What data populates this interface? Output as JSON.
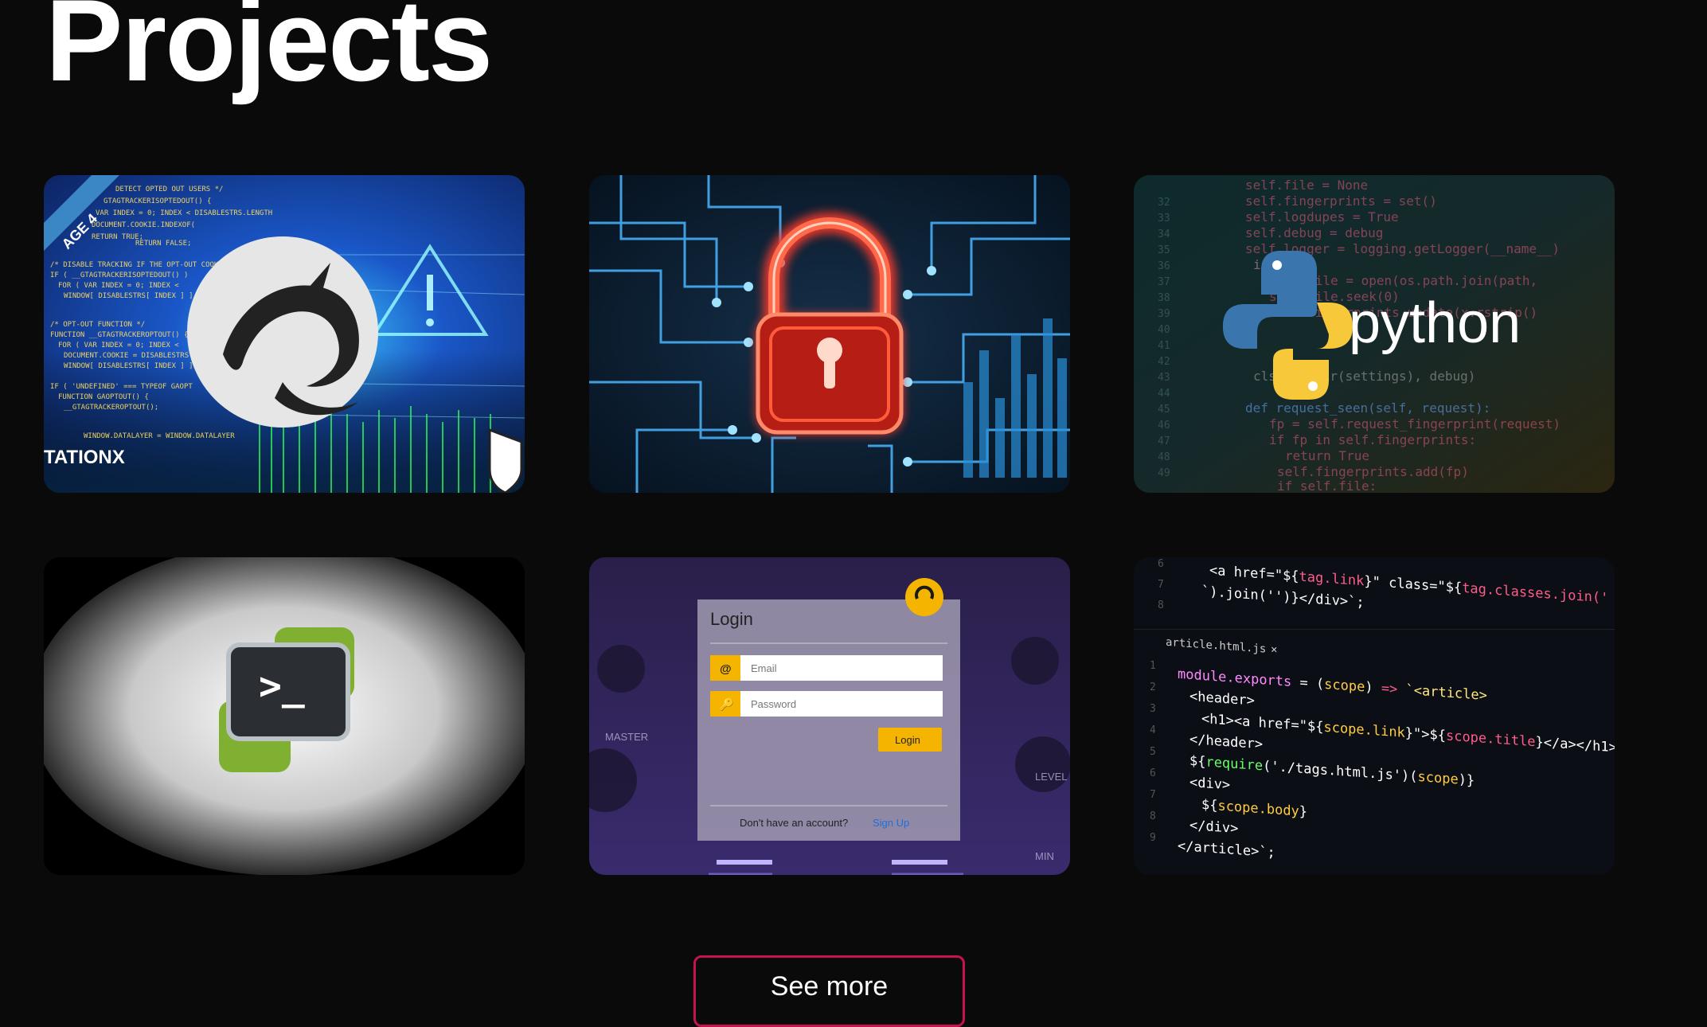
{
  "page": {
    "title": "Projects"
  },
  "projects": [
    {
      "name": "kali-linux-card",
      "icon": "kali-dragon-icon",
      "badge": "TATIONX",
      "ribbon": "AGE 4"
    },
    {
      "name": "cyber-lock-card",
      "icon": "padlock-icon"
    },
    {
      "name": "python-card",
      "icon": "python-logo-icon",
      "logo_text": "python"
    },
    {
      "name": "terminal-app-card",
      "icon": "terminal-icon",
      "prompt": ">_"
    },
    {
      "name": "login-form-card",
      "login": {
        "title": "Login",
        "email_placeholder": "Email",
        "password_placeholder": "Password",
        "button": "Login",
        "no_account": "Don't have an account?",
        "signup": "Sign Up"
      }
    },
    {
      "name": "html-js-code-card",
      "file_tab": "article.html.js"
    }
  ],
  "see_more": {
    "label": "See more"
  },
  "colors": {
    "accent_border": "#c8114f",
    "background": "#0a0a0a",
    "python_blue": "#3a76ad",
    "python_yellow": "#f7c93a",
    "login_yellow": "#f5b400"
  }
}
